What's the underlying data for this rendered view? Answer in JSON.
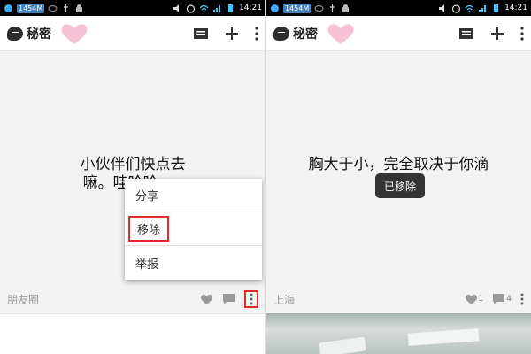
{
  "status_bar": {
    "chip": "1454M",
    "time": "14:21"
  },
  "app": {
    "title": "秘密"
  },
  "left": {
    "post": {
      "line1": "小伙伴们快点去",
      "line2": "嘛。哇哈哈。u"
    },
    "source": "朋友圈",
    "menu": [
      {
        "label": "分享"
      },
      {
        "label": "移除"
      },
      {
        "label": "举报"
      }
    ]
  },
  "right": {
    "post": {
      "line1": "胸大于小，完全取决于你滴"
    },
    "toast": "已移除",
    "location": "上海",
    "like_count": "1",
    "comment_count": "4"
  },
  "colors": {
    "highlight": "#e0292b",
    "toast_bg": "#333333",
    "background": "#f2f2f2"
  }
}
